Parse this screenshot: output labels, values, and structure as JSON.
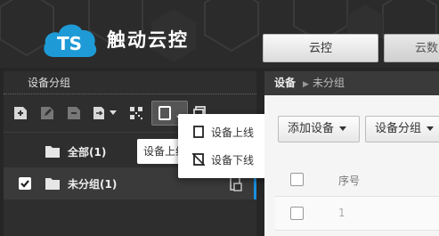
{
  "header": {
    "logo_badge": "TS",
    "logo_text": "触动云控",
    "tabs": [
      {
        "label": "云控",
        "active": true
      },
      {
        "label": "云数",
        "active": false
      }
    ]
  },
  "left_panel": {
    "title": "设备分组",
    "toolbar_icons": [
      "add-icon",
      "edit-icon",
      "remove-icon",
      "export-icon",
      "qrcode-icon",
      "device-select-icon",
      "copy-icon"
    ],
    "tree": [
      {
        "label": "全部(1)",
        "checked": false,
        "selected": false
      },
      {
        "label": "未分组(1)",
        "checked": true,
        "selected": true
      }
    ],
    "tooltip": "设备上线"
  },
  "dropdown": {
    "items": [
      {
        "label": "设备上线",
        "icon": "device-online-icon"
      },
      {
        "label": "设备下线",
        "icon": "device-offline-icon"
      }
    ]
  },
  "right_panel": {
    "breadcrumb": {
      "root": "设备",
      "current": "未分组"
    },
    "buttons": {
      "add_device": "添加设备",
      "device_group": "设备分组"
    },
    "table": {
      "header": "序号",
      "rows": [
        "1"
      ]
    }
  },
  "colors": {
    "accent": "#1a8fe0",
    "panel_dark": "#2e2e2e",
    "logo_blue": "#1e9bd7"
  }
}
